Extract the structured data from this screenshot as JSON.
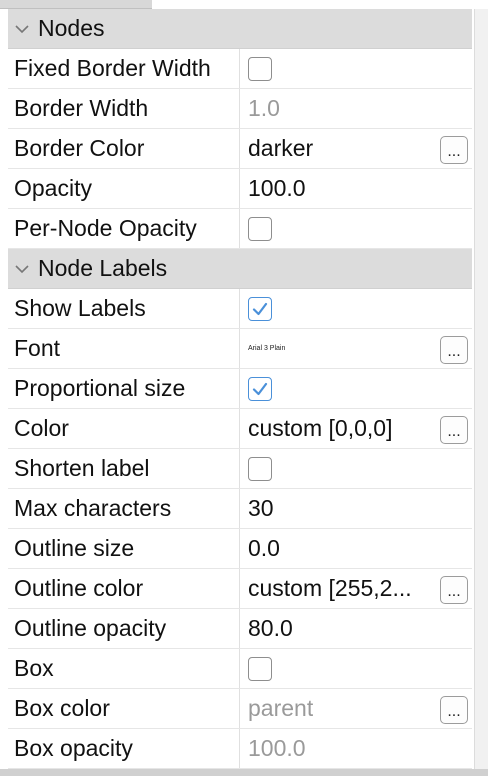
{
  "sections": [
    {
      "title": "Nodes",
      "rows": [
        {
          "label": "Fixed Border Width",
          "type": "checkbox",
          "checked": false
        },
        {
          "label": "Border Width",
          "type": "text",
          "value": "1.0",
          "disabled": true
        },
        {
          "label": "Border Color",
          "type": "picker",
          "value": "darker",
          "button": "..."
        },
        {
          "label": "Opacity",
          "type": "text",
          "value": "100.0"
        },
        {
          "label": "Per-Node Opacity",
          "type": "checkbox",
          "checked": false
        }
      ]
    },
    {
      "title": "Node Labels",
      "rows": [
        {
          "label": "Show Labels",
          "type": "checkbox",
          "checked": true
        },
        {
          "label": "Font",
          "type": "font",
          "value": "Arial 3 Plain",
          "button": "..."
        },
        {
          "label": "Proportional size",
          "type": "checkbox",
          "checked": true
        },
        {
          "label": "Color",
          "type": "picker",
          "value": "custom [0,0,0]",
          "button": "..."
        },
        {
          "label": "Shorten label",
          "type": "checkbox",
          "checked": false
        },
        {
          "label": "Max characters",
          "type": "text",
          "value": "30"
        },
        {
          "label": "Outline size",
          "type": "text",
          "value": "0.0"
        },
        {
          "label": "Outline color",
          "type": "picker",
          "value": "custom [255,2...",
          "button": "..."
        },
        {
          "label": "Outline opacity",
          "type": "text",
          "value": "80.0"
        },
        {
          "label": "Box",
          "type": "checkbox",
          "checked": false
        },
        {
          "label": "Box color",
          "type": "picker",
          "value": "parent",
          "disabled": true,
          "button": "..."
        },
        {
          "label": "Box opacity",
          "type": "text",
          "value": "100.0",
          "disabled": true
        }
      ]
    }
  ],
  "icons": {
    "section_toggle": "chevron-down-icon",
    "checked_mark": "checkmark-icon"
  },
  "colors": {
    "section_header_bg": "#dcdcdc",
    "checkbox_accent": "#4a90d9",
    "disabled_text": "#9a9a9a"
  }
}
